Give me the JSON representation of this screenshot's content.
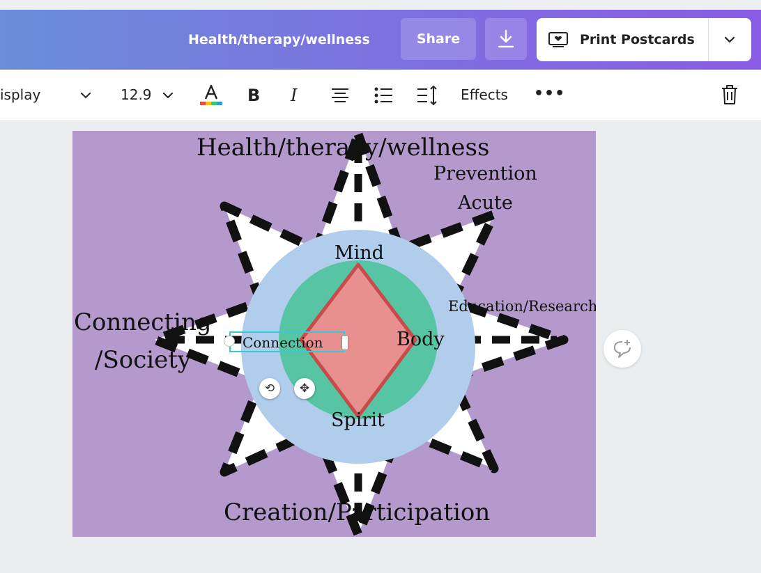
{
  "header": {
    "title": "Health/therapy/wellness",
    "share_label": "Share",
    "download_icon": "download-icon",
    "print_label": "Print Postcards",
    "print_icon": "postcard-icon",
    "print_menu_icon": "chevron-down-icon"
  },
  "toolbar": {
    "font_name": "isplay",
    "font_size": "12.9",
    "text_color_icon": "text-color-icon",
    "bold_icon": "bold-icon",
    "italic_icon": "italic-icon",
    "align_icon": "align-center-icon",
    "list_icon": "bullet-list-icon",
    "spacing_icon": "line-spacing-icon",
    "effects_label": "Effects",
    "more_label": "•••",
    "delete_icon": "trash-icon"
  },
  "design": {
    "title": "Health/therapy/wellness",
    "prevention": "Prevention",
    "acute": "Acute",
    "mind": "Mind",
    "education": "Education/Research",
    "connecting_line1": "Connecting",
    "connecting_line2": "/Society",
    "body": "Body",
    "spirit": "Spirit",
    "creation": "Creation/Participation",
    "selected_text": "Connection",
    "rotate_glyph": "⟲",
    "move_glyph": "✥",
    "colors": {
      "background": "#b399cc",
      "outer_circle": "#b0cdec",
      "inner_circle": "#57c4a3",
      "diamond_fill": "#e89090",
      "diamond_stroke": "#c94a4a",
      "star_fill": "#ffffff",
      "selection": "#38c9d9"
    }
  },
  "comment_icon": "add-comment-icon"
}
